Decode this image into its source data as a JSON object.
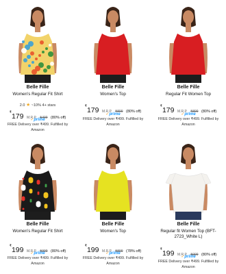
{
  "products": [
    {
      "brand": "Belle Fille",
      "title": "Women's Regular Fit Shirt",
      "rating": "2.0",
      "rating_extra": "~10% 4+ stars",
      "currency": "₹",
      "price": "179",
      "mrp_label": "M.R.P.",
      "mrp": "₹499",
      "discount": "(80% off)",
      "prime": "prime",
      "delivery": "FREE Delivery over ₹499. Fulfilled by Amazon",
      "top_color": "#f2d36a",
      "skin": "#c98a63",
      "pattern": "floral-yellow"
    },
    {
      "brand": "Belle Fille",
      "title": "Women's Top",
      "currency": "₹",
      "price": "179",
      "mrp_label": "M.R.P.",
      "mrp": "₹899",
      "discount": "(80% off)",
      "prime": "prime",
      "delivery": "FREE Delivery over ₹499. Fulfilled by Amazon",
      "top_color": "#d81e22",
      "skin": "#c98a63",
      "pattern": "solid"
    },
    {
      "brand": "Belle Fille",
      "title": "Regular Fit Women Top",
      "currency": "₹",
      "price": "179",
      "mrp_label": "M.R.P.",
      "mrp": "₹899",
      "discount": "(80% off)",
      "prime": "prime",
      "delivery": "FREE Delivery over ₹499. Fulfilled by Amazon",
      "top_color": "#d81e22",
      "skin": "#c98a63",
      "pattern": "solid"
    },
    {
      "brand": "Belle Fille",
      "title": "Women's Regular Fit Shirt",
      "currency": "₹",
      "price": "199",
      "mrp_label": "M.R.P.",
      "mrp": "₹999",
      "discount": "(80% off)",
      "prime": "prime",
      "delivery": "FREE Delivery over ₹499. Fulfilled by Amazon",
      "top_color": "#1a1a1a",
      "skin": "#c98a63",
      "pattern": "floral-black"
    },
    {
      "brand": "Belle Fille",
      "title": "Women's Top",
      "currency": "₹",
      "price": "199",
      "mrp_label": "M.R.P.",
      "mrp": "₹899",
      "discount": "(78% off)",
      "prime": "prime",
      "delivery": "FREE Delivery over ₹499. Fulfilled by Amazon",
      "top_color": "#e6e221",
      "skin": "#c98a63",
      "pattern": "solid"
    },
    {
      "brand": "Belle Fille",
      "title": "Regular fit Women Top (BFT-2723_White L)",
      "currency": "₹",
      "price": "199",
      "mrp_label": "M.R.P.",
      "mrp": "₹999",
      "discount": "(80% off)",
      "prime": "prime",
      "delivery": "FREE Delivery over ₹499. Fulfilled by Amazon",
      "top_color": "#f4f2ee",
      "skin": "#c98a63",
      "pattern": "cold-shoulder"
    }
  ]
}
